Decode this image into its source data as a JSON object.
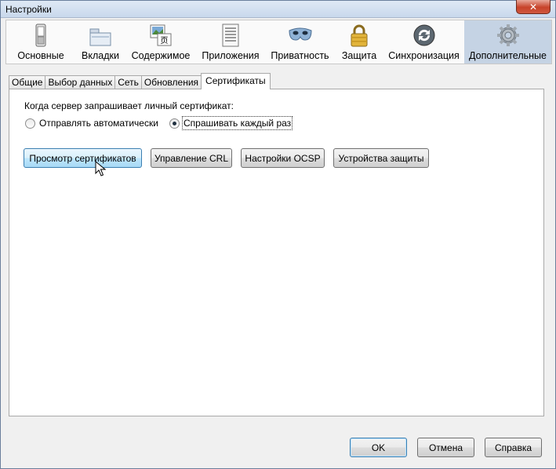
{
  "window": {
    "title": "Настройки"
  },
  "toolbar": {
    "items": [
      {
        "label": "Основные",
        "icon": "switch-icon"
      },
      {
        "label": "Вкладки",
        "icon": "tabs-icon"
      },
      {
        "label": "Содержимое",
        "icon": "content-icon"
      },
      {
        "label": "Приложения",
        "icon": "applications-icon"
      },
      {
        "label": "Приватность",
        "icon": "mask-icon"
      },
      {
        "label": "Защита",
        "icon": "lock-icon"
      },
      {
        "label": "Синхронизация",
        "icon": "sync-icon"
      },
      {
        "label": "Дополнительные",
        "icon": "gear-icon"
      }
    ],
    "active": "Дополнительные"
  },
  "tabs": {
    "items": [
      "Общие",
      "Выбор данных",
      "Сеть",
      "Обновления",
      "Сертификаты"
    ],
    "active": "Сертификаты"
  },
  "certificates": {
    "question": "Когда сервер запрашивает личный сертификат:",
    "option_auto": "Отправлять автоматически",
    "option_ask": "Спрашивать каждый раз",
    "selected": "option_ask",
    "buttons": {
      "view": "Просмотр сертификатов",
      "crl": "Управление CRL",
      "ocsp": "Настройки OCSP",
      "devices": "Устройства защиты"
    }
  },
  "dialog": {
    "ok": "OK",
    "cancel": "Отмена",
    "help": "Справка"
  },
  "colors": {
    "active_tab_bg": "#c5d3e4",
    "hover_button": "#bee6fd",
    "close_button": "#c7432a"
  }
}
